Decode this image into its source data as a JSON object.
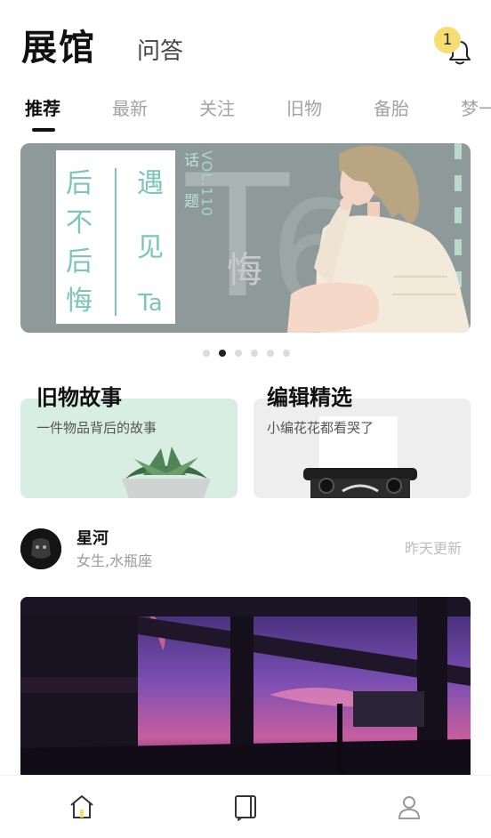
{
  "header": {
    "title": "展馆",
    "subtitle_tab": "问答",
    "notification_count": "1"
  },
  "tabs": [
    "推荐",
    "最新",
    "关注",
    "旧物",
    "备胎",
    "梦一"
  ],
  "banner": {
    "card_col_left": [
      "后",
      "不",
      "后",
      "悔"
    ],
    "card_col_right": [
      "遇",
      "见",
      "Ta"
    ],
    "side_text": [
      "话",
      "题"
    ],
    "vol": "VOL.110",
    "bg_big": "悔",
    "page_indicator": {
      "count": 6,
      "active_index": 1
    }
  },
  "categories": [
    {
      "title": "旧物故事",
      "subtitle": "一件物品背后的故事"
    },
    {
      "title": "编辑精选",
      "subtitle": "小编花花都看哭了"
    }
  ],
  "feed": {
    "user_name": "星河",
    "user_meta": "女生,水瓶座",
    "updated": "昨天更新"
  },
  "bottom_nav": [
    "home-icon",
    "book-icon",
    "profile-icon"
  ],
  "colors": {
    "accent_yellow": "#f6de73",
    "mint": "#7bc6b6",
    "banner_gray": "#8e9a9a"
  }
}
